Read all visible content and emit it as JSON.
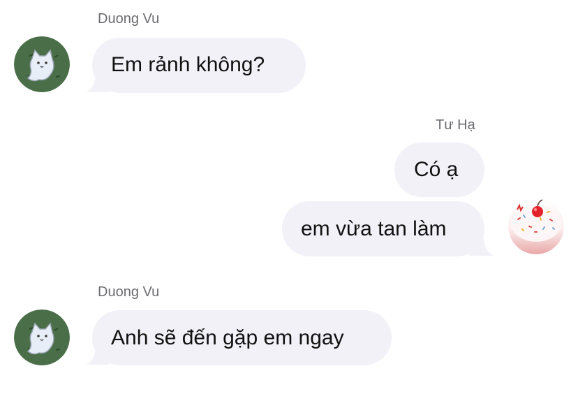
{
  "conversation": {
    "messages": [
      {
        "sender": "Duong Vu",
        "text": "Em rảnh không?"
      },
      {
        "sender": "Tư Hạ",
        "text": "Có ạ"
      },
      {
        "text": "em vừa tan làm"
      },
      {
        "sender": "Duong Vu",
        "text": "Anh sẽ đến gặp em ngay"
      }
    ]
  },
  "avatars": {
    "duong_vu": {
      "icon": "cat-ghost-avatar-icon",
      "bg": "#4a6e48"
    },
    "tu_ha": {
      "icon": "donut-avatar-icon",
      "bg": "#f6d7d6"
    }
  },
  "colors": {
    "bubble": "#f1f1f7",
    "sender_name": "#6b6b70",
    "text": "#111111"
  }
}
